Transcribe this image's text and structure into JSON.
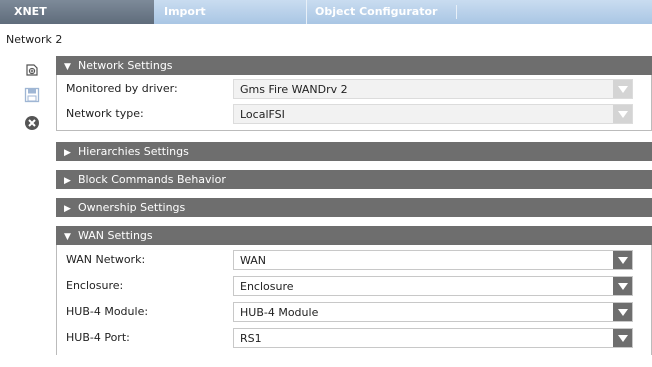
{
  "tabs": [
    {
      "label": "XNET"
    },
    {
      "label": "Import"
    },
    {
      "label": "Object Configurator"
    }
  ],
  "page_title": "Network 2",
  "sidebar_icons": [
    "add-icon",
    "save-icon",
    "close-icon"
  ],
  "sections": {
    "network": {
      "title": "Network Settings",
      "expanded": true,
      "rows": [
        {
          "label": "Monitored by driver:",
          "value": "Gms Fire WANDrv 2",
          "enabled": false
        },
        {
          "label": "Network type:",
          "value": "LocalFSI",
          "enabled": false
        }
      ]
    },
    "hierarchies": {
      "title": "Hierarchies Settings",
      "expanded": false
    },
    "block_commands": {
      "title": "Block Commands Behavior",
      "expanded": false
    },
    "ownership": {
      "title": "Ownership Settings",
      "expanded": false
    },
    "wan": {
      "title": "WAN Settings",
      "expanded": true,
      "rows": [
        {
          "label": "WAN Network:",
          "value": "WAN",
          "enabled": true
        },
        {
          "label": "Enclosure:",
          "value": "Enclosure",
          "enabled": true
        },
        {
          "label": "HUB-4 Module:",
          "value": "HUB-4 Module",
          "enabled": true
        },
        {
          "label": "HUB-4 Port:",
          "value": "RS1",
          "enabled": true
        }
      ]
    }
  },
  "colors": {
    "section_header": "#6e6e6e",
    "tab_bar": "#a9c6e4",
    "active_tab": "#6b7888"
  },
  "glyphs": {
    "expanded": "▼",
    "collapsed": "▶"
  }
}
